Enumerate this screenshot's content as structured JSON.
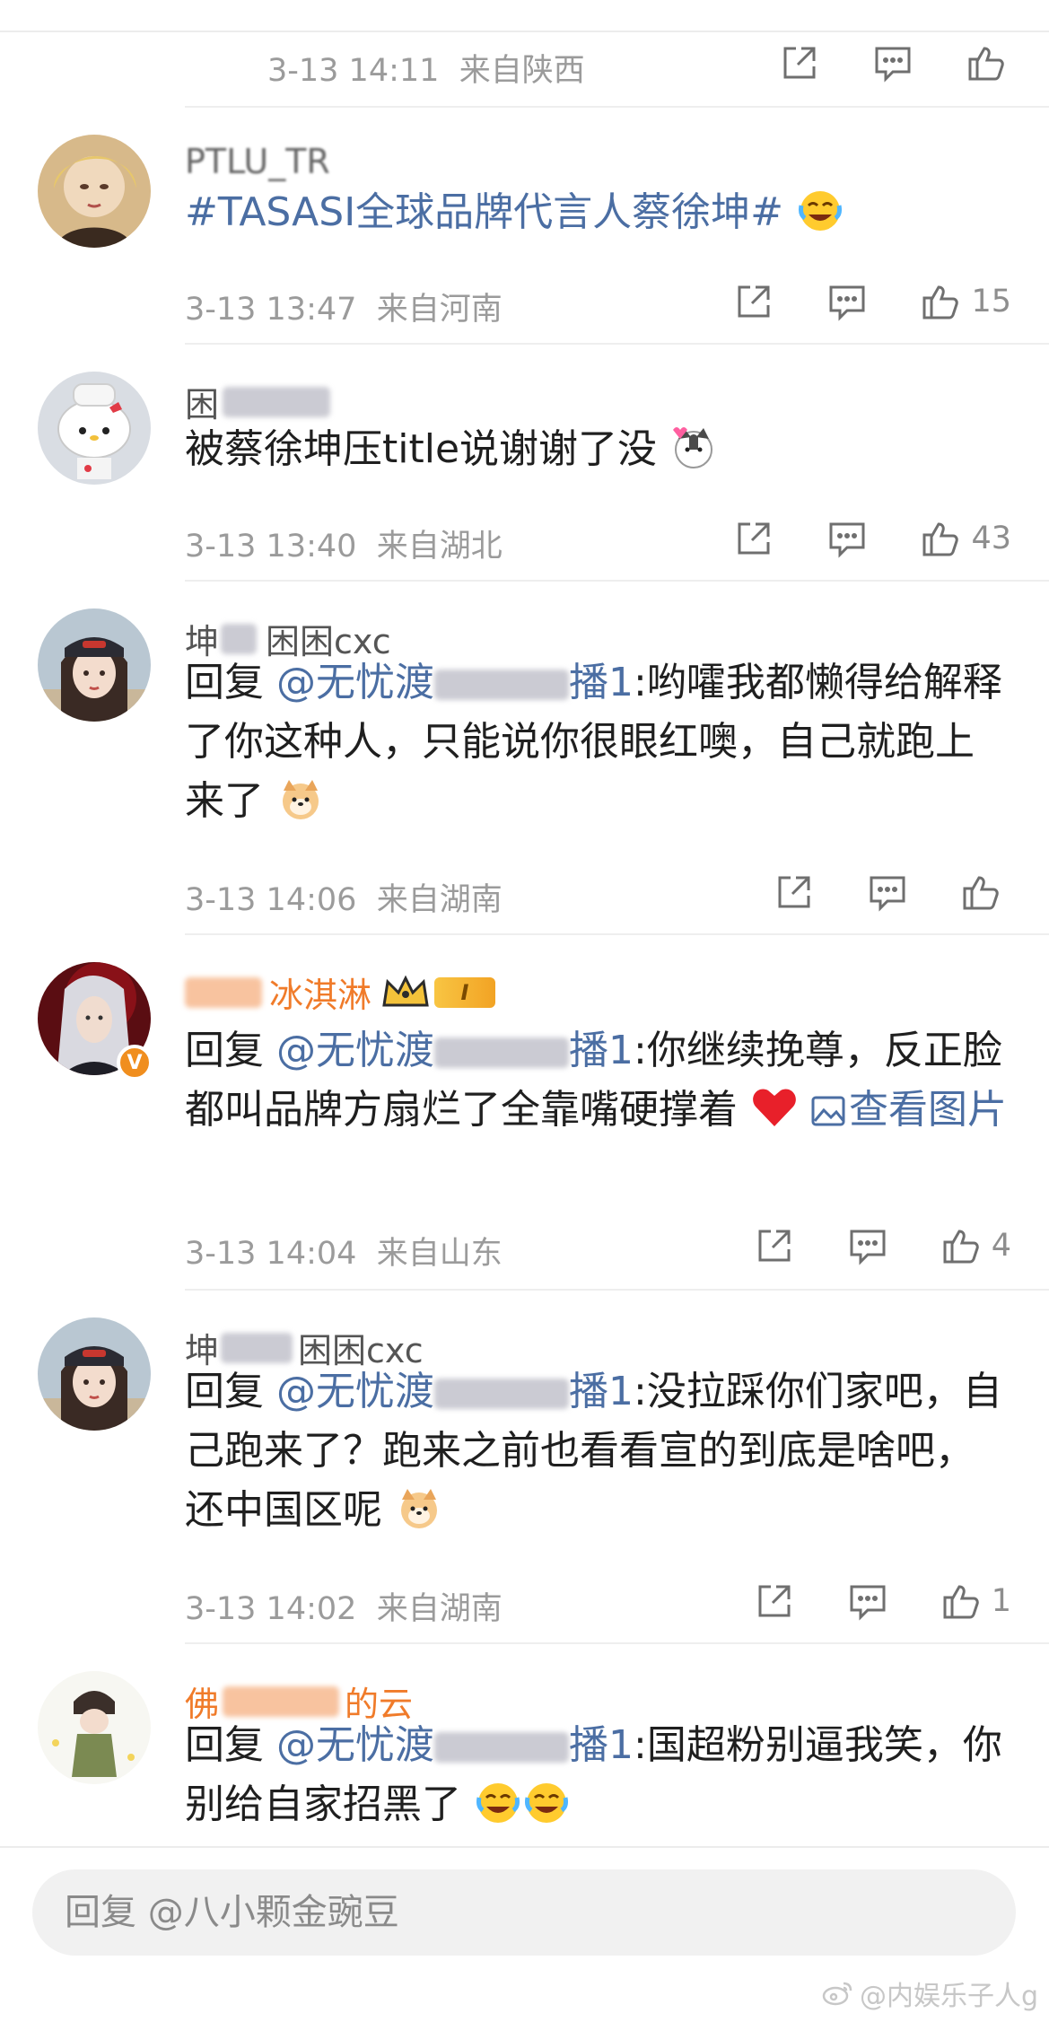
{
  "header": {
    "timestamp": "3-13 14:11",
    "location": "来自陕西"
  },
  "comments": [
    {
      "username": "PTLU_TR",
      "text": "#TASASI全球品牌代言人蔡徐坤#",
      "emoji": "crying-laugh-emoji",
      "timestamp": "3-13 13:47",
      "location": "来自河南",
      "likes": "15"
    },
    {
      "username_prefix": "困",
      "username_suffix": "",
      "text": "被蔡徐坤压title说谢谢了没",
      "emoji": "cat-emoji",
      "timestamp": "3-13 13:40",
      "location": "来自湖北",
      "likes": "43"
    },
    {
      "username_prefix": "坤",
      "username_suffix": "困困cxc",
      "reply_prefix": "回复",
      "mention": "@无忧渡",
      "mention_tail": "播1",
      "text": ":哟嚯我都懒得给解释了你这种人，只能说你很眼红噢，自己就跑上来了",
      "emoji": "dog-emoji",
      "timestamp": "3-13 14:06",
      "location": "来自湖南",
      "likes": ""
    },
    {
      "username_suffix": "冰淇淋",
      "level_badge": "I",
      "reply_prefix": "回复",
      "mention": "@无忧渡",
      "mention_tail": "播1",
      "text": ":你继续挽尊，反正脸都叫品牌方扇烂了全靠嘴硬撑着",
      "emoji": "red-heart-emoji",
      "image_link": "查看图片",
      "timestamp": "3-13 14:04",
      "location": "来自山东",
      "likes": "4",
      "verified_badge": "V"
    },
    {
      "username_prefix": "坤",
      "username_suffix": "困困cxc",
      "reply_prefix": "回复",
      "mention": "@无忧渡",
      "mention_tail": "播1",
      "text": ":没拉踩你们家吧，自己跑来了？跑来之前也看看宣的到底是啥吧，还中国区呢",
      "emoji": "dog-emoji",
      "timestamp": "3-13 14:02",
      "location": "来自湖南",
      "likes": "1"
    },
    {
      "username_prefix": "佛",
      "username_suffix": "的云",
      "reply_prefix": "回复",
      "mention": "@无忧渡",
      "mention_tail": "播1",
      "text": ":国超粉别逼我笑，你别给自家招黑了",
      "emoji": "crying-laugh-emoji"
    }
  ],
  "reply_bar": {
    "placeholder": "回复 @八小颗金豌豆"
  },
  "watermark": "@内娱乐子人g",
  "colors": {
    "link": "#4b6ea3",
    "meta": "#9b9b9b",
    "orange_name": "#f07b2a"
  }
}
